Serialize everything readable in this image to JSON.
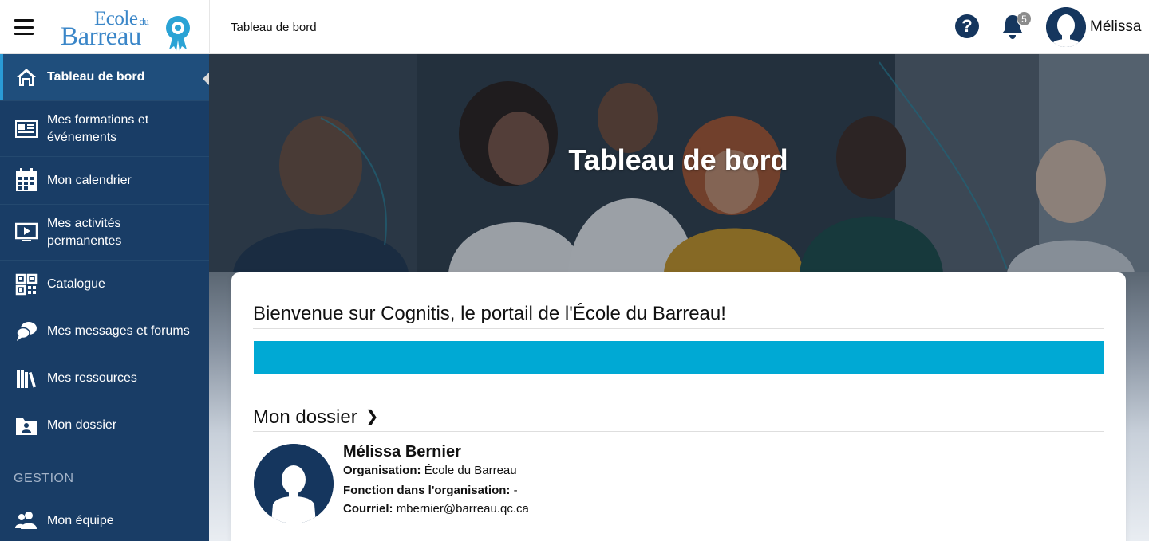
{
  "header": {
    "logo": {
      "line1": "Ecole",
      "line1_small": "du",
      "line2": "Barreau"
    },
    "title": "Tableau de bord",
    "notifications_count": "5",
    "user_name": "Mélissa"
  },
  "sidebar": {
    "items": [
      {
        "label": "Tableau de bord",
        "icon": "home-icon",
        "active": true
      },
      {
        "label": "Mes formations et événements",
        "icon": "newspaper-icon"
      },
      {
        "label": "Mon calendrier",
        "icon": "calendar-icon"
      },
      {
        "label": "Mes activités permanentes",
        "icon": "play-screen-icon"
      },
      {
        "label": "Catalogue",
        "icon": "qr-grid-icon"
      },
      {
        "label": "Mes messages et forums",
        "icon": "chat-bubbles-icon"
      },
      {
        "label": "Mes ressources",
        "icon": "books-icon"
      },
      {
        "label": "Mon dossier",
        "icon": "folder-user-icon"
      }
    ],
    "section_label": "GESTION",
    "section_items": [
      {
        "label": "Mon équipe",
        "icon": "team-icon"
      }
    ]
  },
  "hero": {
    "title": "Tableau de bord"
  },
  "main": {
    "welcome": "Bienvenue sur Cognitis, le portail de l'École du Barreau!",
    "dossier_title": "Mon dossier",
    "profile": {
      "name": "Mélissa Bernier",
      "organisation_label": "Organisation:",
      "organisation": "École du Barreau",
      "fonction_label": "Fonction dans l'organisation:",
      "fonction": "-",
      "courriel_label": "Courriel:",
      "courriel": "mbernier@barreau.qc.ca"
    }
  },
  "colors": {
    "sidebar_bg": "#193d66",
    "sidebar_active": "#1f4e7c",
    "banner": "#00a9d4",
    "brand_navy": "#15365e",
    "logo_blue": "#3a86c8"
  }
}
